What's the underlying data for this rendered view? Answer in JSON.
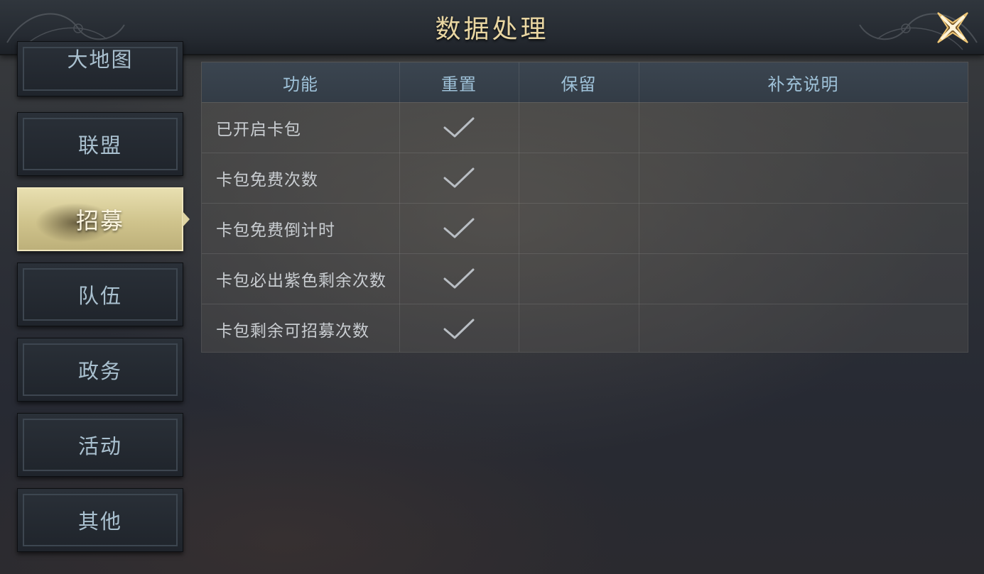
{
  "header": {
    "title": "数据处理",
    "close_icon": "close-x-icon"
  },
  "sidebar": {
    "items": [
      {
        "label": "大地图",
        "active": false
      },
      {
        "label": "联盟",
        "active": false
      },
      {
        "label": "招募",
        "active": true
      },
      {
        "label": "队伍",
        "active": false
      },
      {
        "label": "政务",
        "active": false
      },
      {
        "label": "活动",
        "active": false
      },
      {
        "label": "其他",
        "active": false
      }
    ]
  },
  "table": {
    "columns": [
      "功能",
      "重置",
      "保留",
      "补充说明"
    ],
    "rows": [
      {
        "function": "已开启卡包",
        "reset": true,
        "keep": "",
        "note": ""
      },
      {
        "function": "卡包免费次数",
        "reset": true,
        "keep": "",
        "note": ""
      },
      {
        "function": "卡包免费倒计时",
        "reset": true,
        "keep": "",
        "note": ""
      },
      {
        "function": "卡包必出紫色剩余次数",
        "reset": true,
        "keep": "",
        "note": ""
      },
      {
        "function": "卡包剩余可招募次数",
        "reset": true,
        "keep": "",
        "note": ""
      }
    ],
    "check_icon": "checkmark-icon"
  },
  "colors": {
    "title": "#e9d6a2",
    "header_text": "#9fc2d9",
    "active_tab": "#d6cb97",
    "close_accent": "#f0c878"
  }
}
